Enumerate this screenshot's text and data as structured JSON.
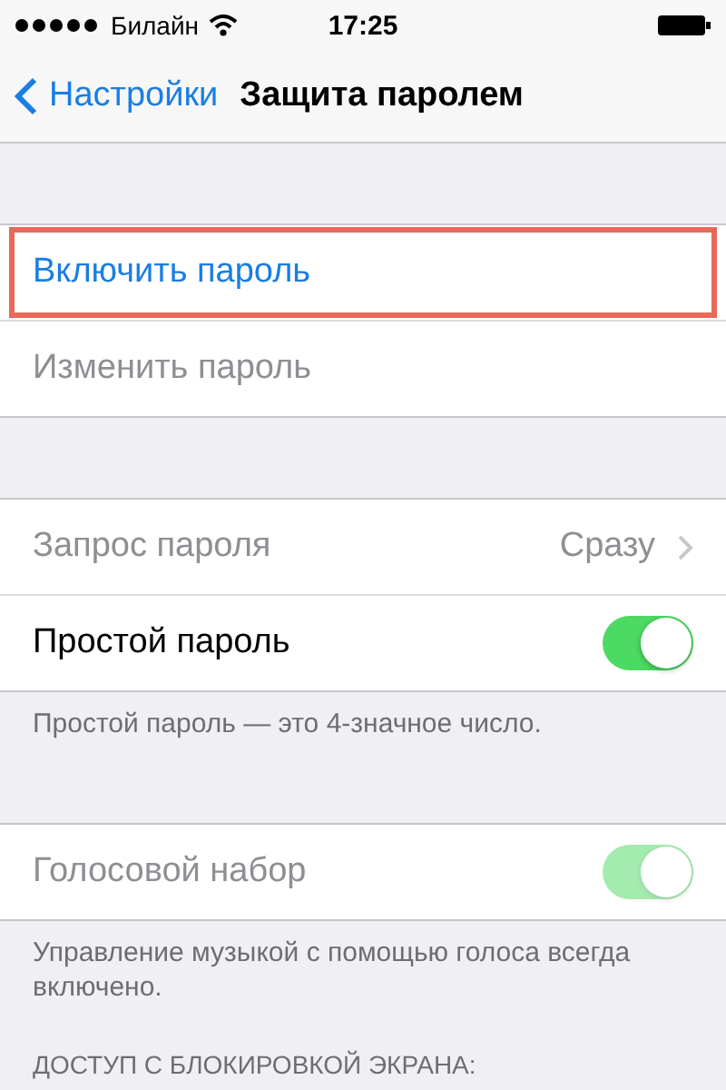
{
  "status_bar": {
    "carrier": "Билайн",
    "time": "17:25"
  },
  "nav": {
    "back": "Настройки",
    "title": "Защита паролем"
  },
  "groups": [
    {
      "rows": [
        {
          "kind": "action",
          "label": "Включить пароль",
          "disabled": false,
          "highlighted": true
        },
        {
          "kind": "action",
          "label": "Изменить пароль",
          "disabled": true,
          "highlighted": false
        }
      ]
    },
    {
      "rows": [
        {
          "kind": "value",
          "label": "Запрос пароля",
          "value": "Сразу",
          "disabled": true,
          "highlighted": false
        },
        {
          "kind": "toggle",
          "label": "Простой пароль",
          "on": true,
          "disabled": false,
          "highlighted": false
        }
      ],
      "footer": "Простой пароль — это 4-значное число."
    },
    {
      "rows": [
        {
          "kind": "toggle",
          "label": "Голосовой набор",
          "on": true,
          "disabled": true,
          "highlighted": false
        }
      ],
      "footer": "Управление музыкой с помощью голоса всегда включено."
    },
    {
      "header": "ДОСТУП С БЛОКИРОВКОЙ ЭКРАНА:"
    }
  ]
}
